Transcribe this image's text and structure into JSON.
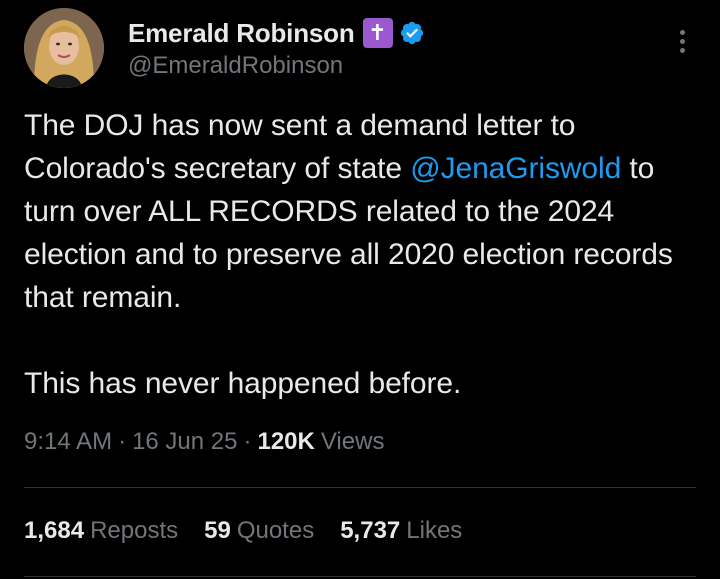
{
  "author": {
    "display_name": "Emerald Robinson",
    "badge_glyph": "✝",
    "handle": "@EmeraldRobinson",
    "verified": true
  },
  "post": {
    "paragraph1_before": "The DOJ has now sent a demand letter to Colorado's secretary of state ",
    "mention": "@JenaGriswold",
    "paragraph1_after": " to turn over ALL RECORDS related to the 2024 election and to preserve all 2020 election records that remain.",
    "paragraph2": "This has never happened before."
  },
  "meta": {
    "time": "9:14 AM",
    "separator": "·",
    "date": "16 Jun 25",
    "views_count": "120K",
    "views_label": "Views"
  },
  "stats": {
    "reposts_count": "1,684",
    "reposts_label": "Reposts",
    "quotes_count": "59",
    "quotes_label": "Quotes",
    "likes_count": "5,737",
    "likes_label": "Likes"
  },
  "colors": {
    "background": "#000000",
    "text_primary": "#e7e9ea",
    "text_secondary": "#71767b",
    "link": "#1d9bf0",
    "verified": "#1d9bf0",
    "badge": "#9b59d0"
  }
}
